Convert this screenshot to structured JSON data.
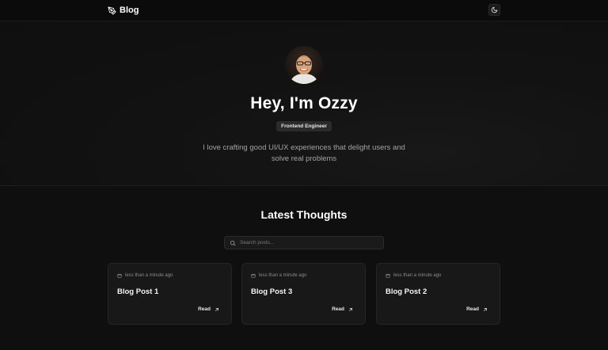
{
  "header": {
    "brand_label": "Blog",
    "brand_icon": "pen-nib-icon",
    "theme_toggle_icon": "moon-icon"
  },
  "hero": {
    "title": "Hey, I'm Ozzy",
    "role_badge": "Frontend Engineer",
    "bio": "I love crafting good UI/UX experiences that delight users and solve real problems"
  },
  "posts_section": {
    "title": "Latest Thoughts",
    "search": {
      "placeholder": "Search posts...",
      "value": ""
    },
    "posts": [
      {
        "date": "less than a minute ago",
        "title": "Blog Post 1",
        "action": "Read"
      },
      {
        "date": "less than a minute ago",
        "title": "Blog Post 3",
        "action": "Read"
      },
      {
        "date": "less than a minute ago",
        "title": "Blog Post 2",
        "action": "Read"
      }
    ]
  },
  "colors": {
    "background": "#0f0f0f",
    "card": "#181818",
    "badge": "#2b2b2b",
    "text_primary": "#ffffff",
    "text_muted": "#a3a3a3"
  }
}
